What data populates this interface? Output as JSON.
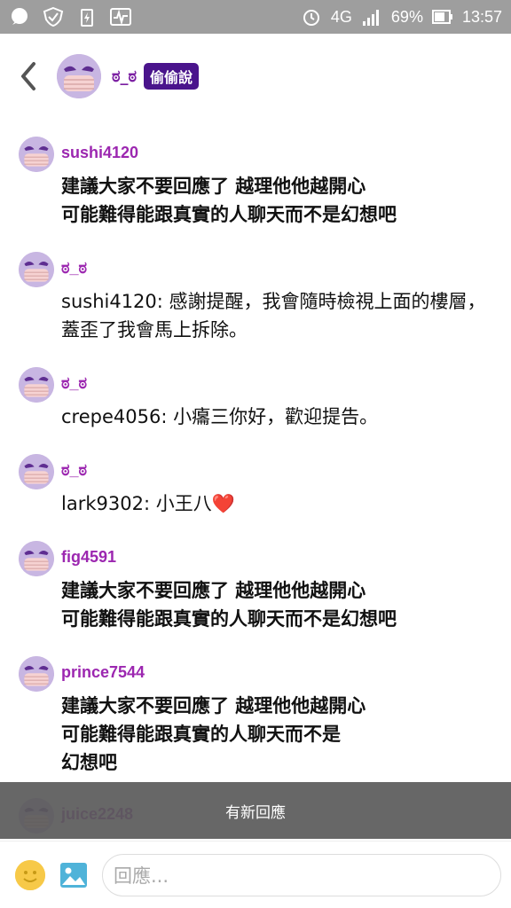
{
  "status_bar": {
    "network": "4G",
    "battery": "69%",
    "time": "13:57"
  },
  "header": {
    "title": "ಠ_ಠ",
    "tag": "偷偷說"
  },
  "messages": [
    {
      "name": "sushi4120",
      "text": "建議大家不要回應了 越理他他越開心\n可能難得能跟真實的人聊天而不是幻想吧",
      "bold": true
    },
    {
      "name": "ಠ_ಠ",
      "text": "sushi4120: 感謝提醒，我會隨時檢視上面的樓層，蓋歪了我會馬上拆除。",
      "bold": false
    },
    {
      "name": "ಠ_ಠ",
      "text": "crepe4056: 小癟三你好，歡迎提告。",
      "bold": false
    },
    {
      "name": "ಠ_ಠ",
      "text": "lark9302: 小王八",
      "bold": false,
      "emoji": "❤️"
    },
    {
      "name": "fig4591",
      "text": "建議大家不要回應了 越理他他越開心\n可能難得能跟真實的人聊天而不是幻想吧",
      "bold": true
    },
    {
      "name": "prince7544",
      "text": "建議大家不要回應了 越理他他越開心\n可能難得能跟真實的人聊天而不是\n幻想吧",
      "bold": true
    },
    {
      "name": "juice2248",
      "text": "",
      "bold": true
    }
  ],
  "banner": "有新回應",
  "composer": {
    "placeholder": "回應..."
  },
  "colors": {
    "name_purple": "#9c27b0",
    "tag_bg": "#4a148c",
    "avatar_bg": "#c8b6e2"
  }
}
